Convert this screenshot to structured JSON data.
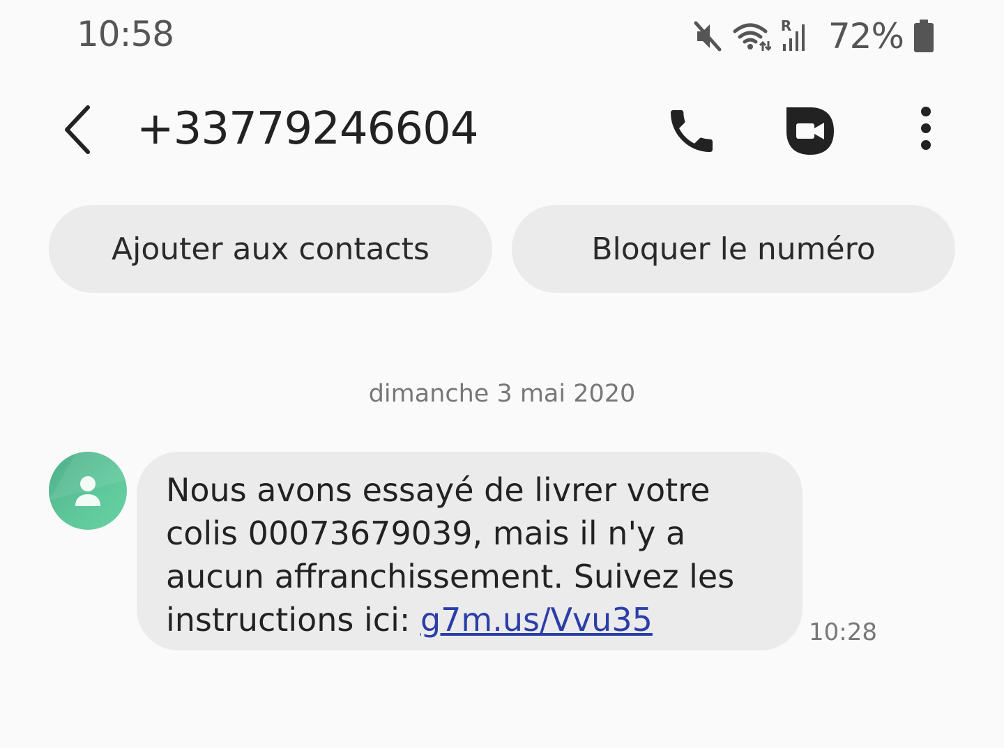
{
  "status_bar": {
    "time": "10:58",
    "icons": [
      "mute-icon",
      "wifi-icon",
      "roaming-signal-icon",
      "battery-icon"
    ],
    "roaming_indicator": "R",
    "battery_level": "72%"
  },
  "header": {
    "back_icon": "chevron-left-icon",
    "contact_number": "+33779246604",
    "actions": [
      "phone-icon",
      "video-call-icon",
      "more-vert-icon"
    ]
  },
  "actions": {
    "add_contact": "Ajouter aux contacts",
    "block_number": "Bloquer le numéro"
  },
  "conversation": {
    "date": "dimanche 3 mai 2020",
    "messages": [
      {
        "sender_avatar": "person-icon",
        "text": "Nous avons essayé de livrer votre colis 00073679039, mais il n'y a aucun affranchissement. Suivez les instructions ici: ",
        "link": "g7m.us/Vvu35",
        "time": "10:28"
      }
    ]
  },
  "colors": {
    "background": "#fafafa",
    "bubble": "#ebebeb",
    "pill": "#ebebeb",
    "link": "#2b3ea8",
    "avatar": "#5ec79a",
    "icon": "#222222"
  }
}
